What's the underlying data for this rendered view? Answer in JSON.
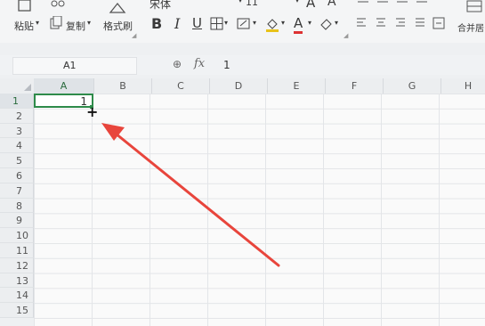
{
  "toolbar": {
    "paste_label": "粘贴",
    "copy_label": "复制",
    "format_painter_label": "格式刷",
    "font_name": "宋体",
    "font_size": "11",
    "bold_label": "B",
    "italic_label": "I",
    "underline_label": "U",
    "font_grow_label": "A",
    "font_shrink_label": "A",
    "font_color_label": "A",
    "merge_label": "合并居"
  },
  "formula_bar": {
    "cell_ref": "A1",
    "fx_label": "fx",
    "value": "1"
  },
  "columns": [
    "A",
    "B",
    "C",
    "D",
    "E",
    "F",
    "G",
    "H"
  ],
  "rows": [
    "1",
    "2",
    "3",
    "4",
    "5",
    "6",
    "7",
    "8",
    "9",
    "10",
    "11",
    "12",
    "13",
    "14",
    "15"
  ],
  "active_cell": {
    "ref": "A1",
    "value": "1"
  },
  "colors": {
    "selection": "#2e8b4a",
    "arrow": "#e8453c"
  }
}
